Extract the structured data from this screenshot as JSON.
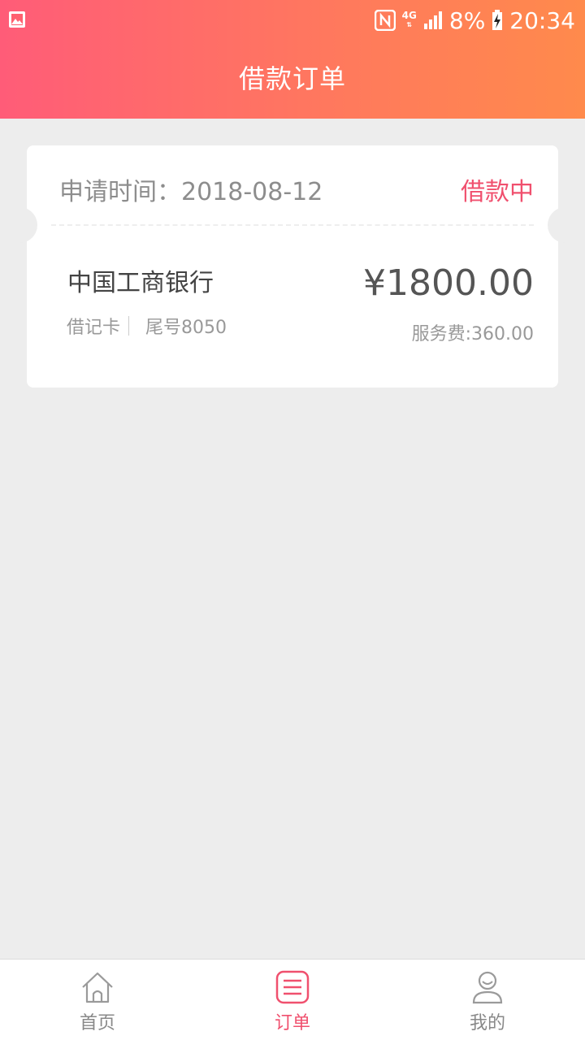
{
  "status_bar": {
    "network": "4G",
    "battery": "8%",
    "time": "20:34",
    "icons": [
      "image-icon",
      "nfc-icon",
      "network-4g-icon",
      "signal-icon",
      "battery-charging-icon"
    ]
  },
  "header": {
    "title": "借款订单",
    "gradient": [
      "#ff5c78",
      "#ff8a4c"
    ]
  },
  "order": {
    "apply_time": "申请时间：2018-08-12",
    "status": "借款中",
    "bank": "中国工商银行",
    "card_type": "借记卡",
    "card_tail": "尾号8050",
    "amount": "¥1800.00",
    "fee": "服务费:360.00"
  },
  "tabbar": {
    "items": [
      {
        "label": "首页",
        "icon": "home-icon",
        "active": false
      },
      {
        "label": "订单",
        "icon": "order-list-icon",
        "active": true
      },
      {
        "label": "我的",
        "icon": "user-icon",
        "active": false
      }
    ],
    "active_color": "#f0506e"
  }
}
